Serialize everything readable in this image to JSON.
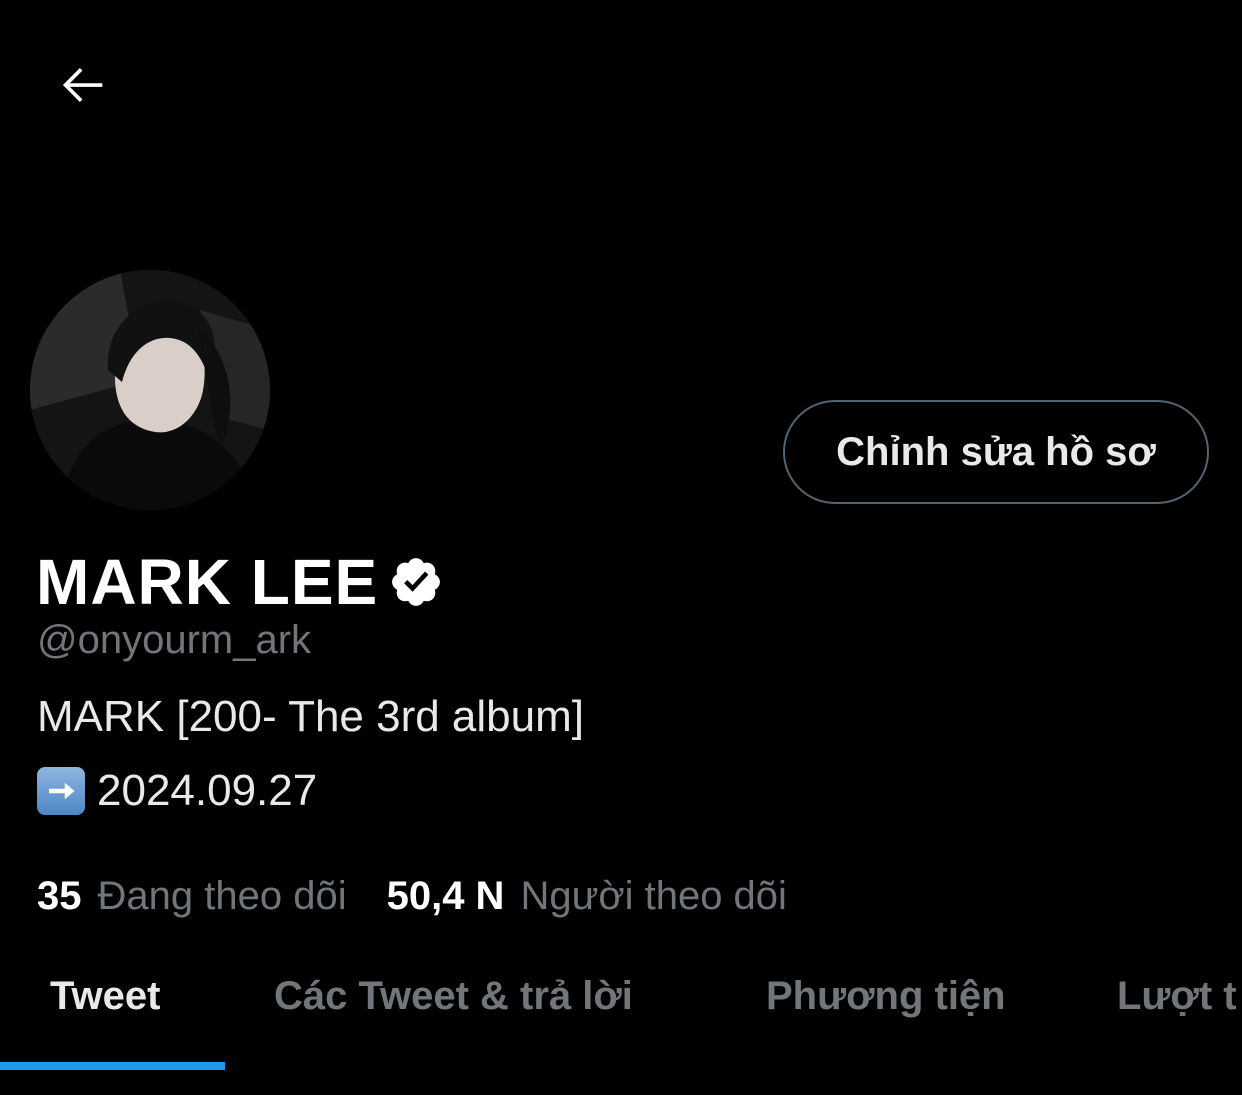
{
  "header": {
    "back_icon": "arrow-left-icon"
  },
  "profile": {
    "avatar_icon": "profile-photo",
    "edit_button_label": "Chỉnh sửa hồ sơ",
    "display_name": "MARK LEE",
    "verified_icon": "verified-badge-icon",
    "handle": "@onyourm_ark",
    "bio_line_1": "MARK [200- The 3rd album]",
    "bio_arrow_icon": "right-arrow-emoji",
    "bio_line_2": "2024.09.27"
  },
  "stats": {
    "following_count": "35",
    "following_label": "Đang theo dõi",
    "followers_count": "50,4 N",
    "followers_label": "Người theo dõi"
  },
  "tabs": [
    {
      "label": "Tweet",
      "active": true
    },
    {
      "label": "Các Tweet & trả lời",
      "active": false
    },
    {
      "label": "Phương tiện",
      "active": false
    },
    {
      "label": "Lượt t",
      "active": false
    }
  ],
  "colors": {
    "background": "#000000",
    "primary_text": "#e7e9ea",
    "secondary_text": "#71767b",
    "accent": "#1d9bf0",
    "border": "#536471"
  }
}
